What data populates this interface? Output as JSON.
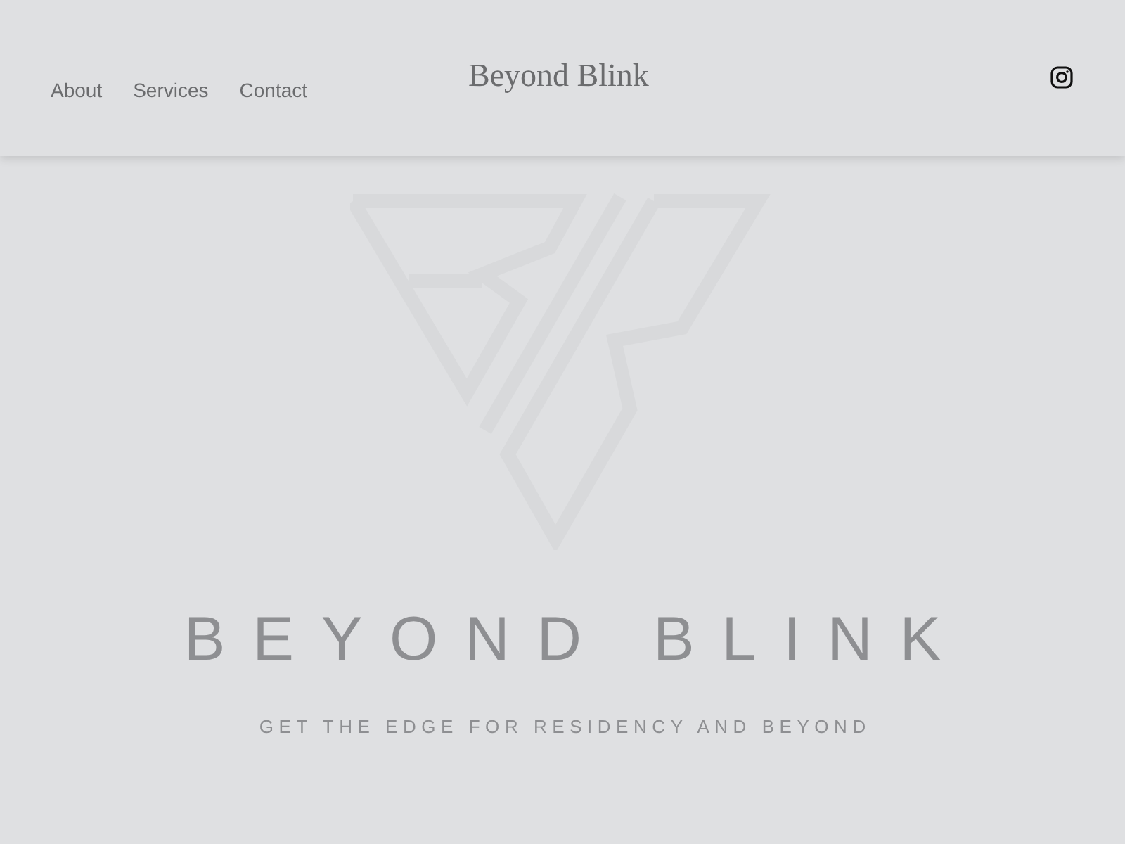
{
  "nav": {
    "links": [
      {
        "label": "About"
      },
      {
        "label": "Services"
      },
      {
        "label": "Contact"
      }
    ],
    "brand": "Beyond Blink"
  },
  "hero": {
    "title": "BEYOND BLINK",
    "tagline": "GET THE EDGE FOR RESIDENCY AND BEYOND"
  }
}
